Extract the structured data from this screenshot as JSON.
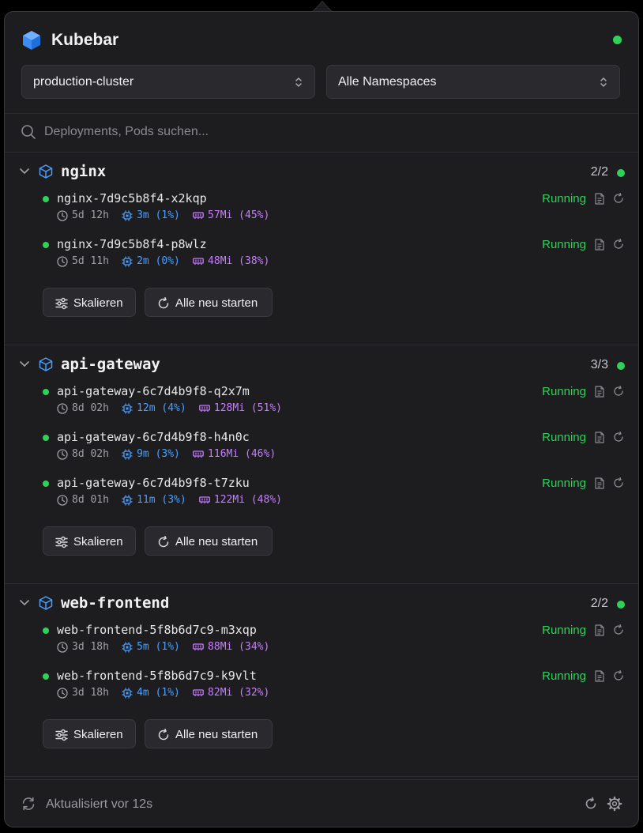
{
  "app": {
    "title": "Kubebar"
  },
  "cluster_select": {
    "value": "production-cluster"
  },
  "namespace_select": {
    "value": "Alle Namespaces"
  },
  "search": {
    "placeholder": "Deployments, Pods suchen..."
  },
  "colors": {
    "running": "#30d158",
    "cpu": "#4a9eff",
    "memory": "#c77dff",
    "accent": "#3b8cf5"
  },
  "deployments": [
    {
      "name": "nginx",
      "ready": "2/2",
      "pods": [
        {
          "name": "nginx-7d9c5b8f4-x2kqp",
          "age": "5d 12h",
          "cpu": "3m (1%)",
          "mem": "57Mi (45%)",
          "status": "Running"
        },
        {
          "name": "nginx-7d9c5b8f4-p8wlz",
          "age": "5d 11h",
          "cpu": "2m (0%)",
          "mem": "48Mi (38%)",
          "status": "Running"
        }
      ],
      "scale_label": "Skalieren",
      "restart_label": "Alle neu starten"
    },
    {
      "name": "api-gateway",
      "ready": "3/3",
      "pods": [
        {
          "name": "api-gateway-6c7d4b9f8-q2x7m",
          "age": "8d 02h",
          "cpu": "12m (4%)",
          "mem": "128Mi (51%)",
          "status": "Running"
        },
        {
          "name": "api-gateway-6c7d4b9f8-h4n0c",
          "age": "8d 02h",
          "cpu": "9m (3%)",
          "mem": "116Mi (46%)",
          "status": "Running"
        },
        {
          "name": "api-gateway-6c7d4b9f8-t7zku",
          "age": "8d 01h",
          "cpu": "11m (3%)",
          "mem": "122Mi (48%)",
          "status": "Running"
        }
      ],
      "scale_label": "Skalieren",
      "restart_label": "Alle neu starten"
    },
    {
      "name": "web-frontend",
      "ready": "2/2",
      "pods": [
        {
          "name": "web-frontend-5f8b6d7c9-m3xqp",
          "age": "3d 18h",
          "cpu": "5m (1%)",
          "mem": "88Mi (34%)",
          "status": "Running"
        },
        {
          "name": "web-frontend-5f8b6d7c9-k9vlt",
          "age": "3d 18h",
          "cpu": "4m (1%)",
          "mem": "82Mi (32%)",
          "status": "Running"
        }
      ],
      "scale_label": "Skalieren",
      "restart_label": "Alle neu starten"
    }
  ],
  "footer": {
    "updated": "Aktualisiert vor 12s"
  }
}
